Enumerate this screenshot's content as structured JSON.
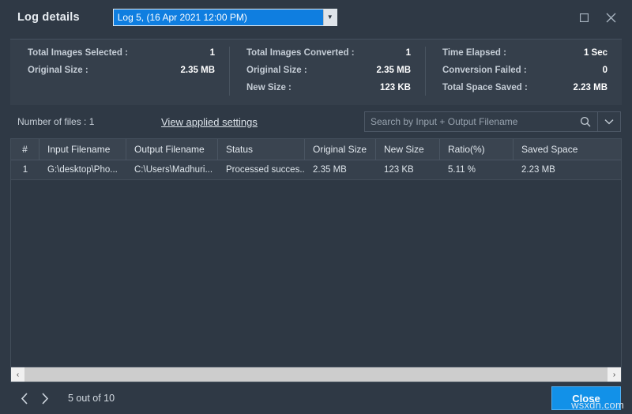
{
  "window": {
    "title": "Log details",
    "log_selector": {
      "value": "Log 5, (16 Apr 2021 12:00 PM)",
      "arrow": "▼"
    },
    "controls": {
      "maximize": "maximize-icon",
      "close": "close-icon"
    }
  },
  "stats": {
    "columns": [
      {
        "rows": [
          {
            "label": "Total Images Selected :",
            "value": "1"
          },
          {
            "label": "Original Size :",
            "value": "2.35 MB"
          }
        ]
      },
      {
        "rows": [
          {
            "label": "Total Images Converted :",
            "value": "1"
          },
          {
            "label": "Original Size :",
            "value": "2.35 MB"
          },
          {
            "label": "New Size :",
            "value": "123 KB"
          }
        ]
      },
      {
        "rows": [
          {
            "label": "Time Elapsed :",
            "value": "1 Sec"
          },
          {
            "label": "Conversion Failed :",
            "value": "0"
          },
          {
            "label": "Total Space Saved :",
            "value": "2.23 MB"
          }
        ]
      }
    ]
  },
  "toolbar": {
    "files_count": "Number of files : 1",
    "applied_settings_link": "View applied settings",
    "search": {
      "placeholder": "Search by Input + Output Filename",
      "value": "",
      "icon": "search-icon",
      "dropdown_icon": "chevron-down-icon"
    }
  },
  "table": {
    "headers": [
      "#",
      "Input Filename",
      "Output Filename",
      "Status",
      "Original Size",
      "New Size",
      "Ratio(%)",
      "Saved Space"
    ],
    "rows": [
      {
        "index": "1",
        "input_filename": "G:\\desktop\\Pho...",
        "output_filename": "C:\\Users\\Madhuri...",
        "status": "Processed succes...",
        "original_size": "2.35 MB",
        "new_size": "123 KB",
        "ratio": "5.11 %",
        "saved_space": "2.23 MB"
      }
    ],
    "scrollbar": {
      "left_arrow": "‹",
      "right_arrow": "›"
    }
  },
  "footer": {
    "prev_icon": "chevron-left-icon",
    "next_icon": "chevron-right-icon",
    "page_status": "5 out of 10",
    "close_label": "Close"
  },
  "watermark": "wsxdn.com",
  "colors": {
    "background": "#2f3945",
    "panel": "#353f4b",
    "accent_blue": "#0f7ee0",
    "button_blue": "#1291e8",
    "header_row": "#3a4450",
    "row": "#36404c"
  }
}
